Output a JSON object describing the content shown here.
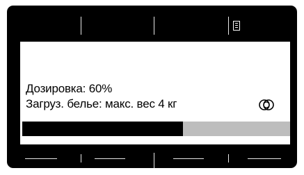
{
  "display": {
    "dosage_text": "Дозировка: 60%",
    "load_text": "Загруз. белье: макс. вес 4 кг",
    "progress_fraction": 0.6
  },
  "icons": {
    "menu": "menu-list-icon",
    "dose": "double-circle-dose-icon"
  },
  "colors": {
    "bezel": "#000000",
    "screen": "#ffffff",
    "progress_fill": "#000000",
    "progress_track": "#bdbdbd",
    "lines": "#e8e8e8"
  }
}
